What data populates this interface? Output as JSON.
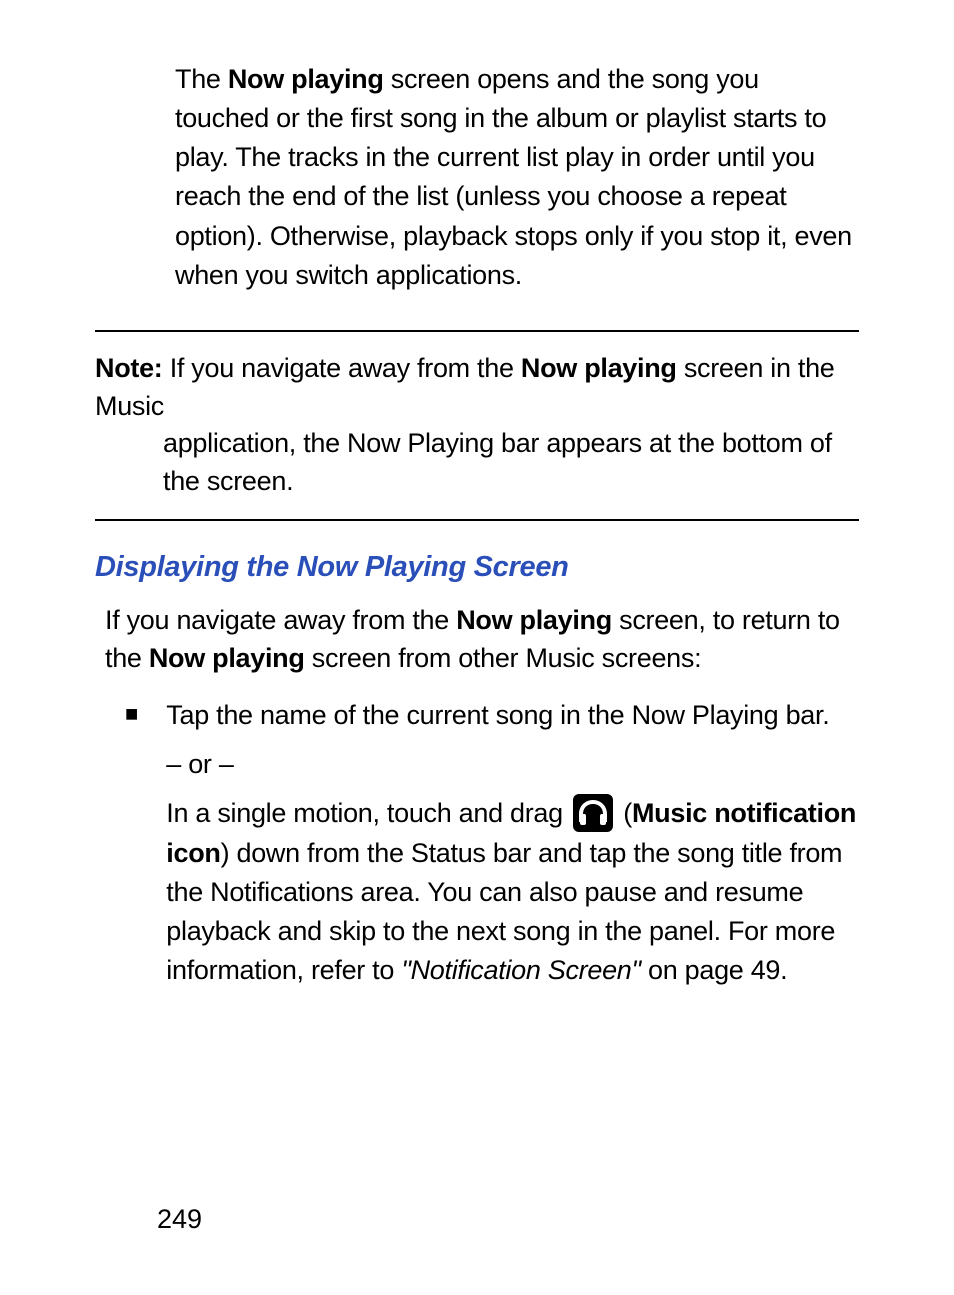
{
  "intro": {
    "prefix": "The ",
    "bold1": "Now playing",
    "rest": " screen opens and the song you touched or the first song in the album or playlist starts to play. The tracks in the current list play in order until you reach the end of the list (unless you choose a repeat option). Otherwise, playback stops only if you stop it, even when you switch applications."
  },
  "note": {
    "label": "Note:",
    "text1": " If you navigate away from the ",
    "bold1": "Now playing",
    "text2": " screen in the Music ",
    "text3": "application, the Now Playing bar appears at the bottom of the screen."
  },
  "heading": "Displaying the Now Playing Screen",
  "para2": {
    "text1": "If you navigate away from the ",
    "bold1": "Now playing",
    "text2": " screen, to return to the ",
    "bold2": "Now playing",
    "text3": " screen from other Music screens:"
  },
  "bullet": {
    "line1": "Tap the name of the current song in the Now Playing bar.",
    "or": "– or –",
    "line2a": "In a single motion, touch and drag ",
    "line2b_open": " (",
    "line2b_bold": "Music notification icon",
    "line2c": ") down from the Status bar and tap the song title from the Notifications area. You can also pause and resume playback and skip to the next song in the panel. For more information, refer to ",
    "line2_ref": "\"Notification Screen\"",
    "line2_end": "  on page 49."
  },
  "page_number": "249",
  "icon_name": "headphones-icon",
  "bullet_marker": "■"
}
